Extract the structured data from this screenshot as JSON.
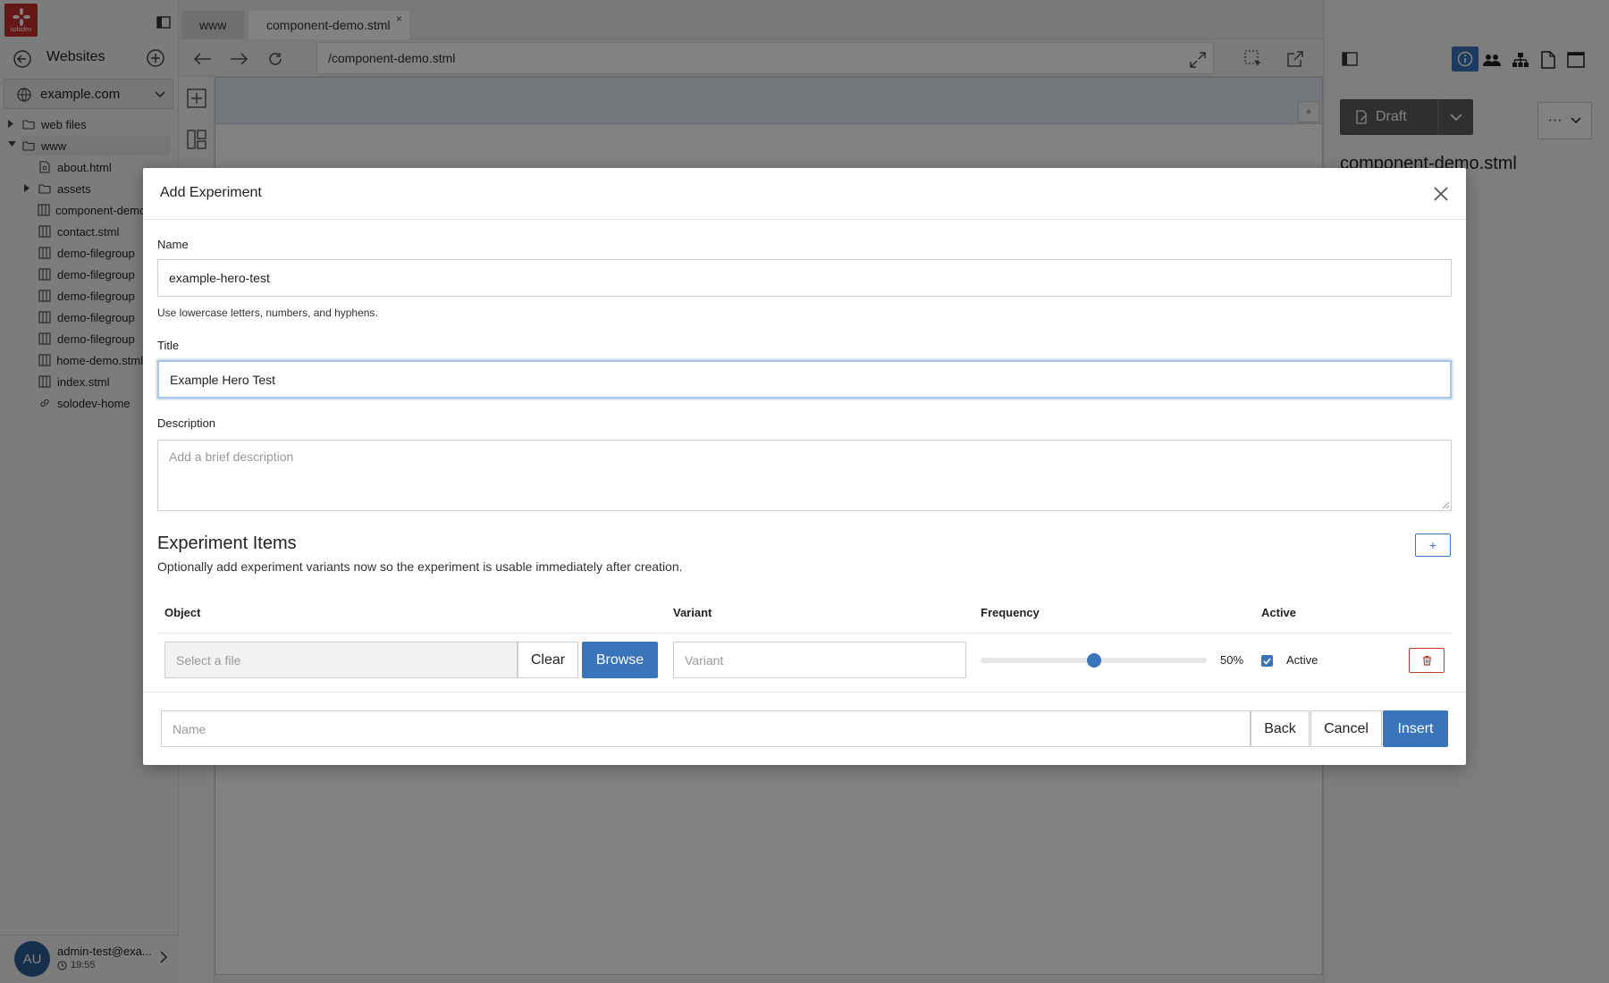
{
  "app": {
    "logo_text": "solodev"
  },
  "sidebar": {
    "websites_label": "Websites",
    "site_select": "example.com",
    "tree": [
      {
        "label": "web files",
        "type": "folder",
        "level": 0,
        "expanded": false
      },
      {
        "label": "www",
        "type": "folder",
        "level": 0,
        "expanded": true
      },
      {
        "label": "about.html",
        "type": "html",
        "level": 1
      },
      {
        "label": "assets",
        "type": "folder",
        "level": 1,
        "expanded": false
      },
      {
        "label": "component-demo.stml",
        "type": "stml",
        "level": 1
      },
      {
        "label": "contact.stml",
        "type": "stml",
        "level": 1
      },
      {
        "label": "demo-filegroup",
        "type": "stml",
        "level": 1
      },
      {
        "label": "demo-filegroup",
        "type": "stml",
        "level": 1
      },
      {
        "label": "demo-filegroup",
        "type": "stml",
        "level": 1
      },
      {
        "label": "demo-filegroup",
        "type": "stml",
        "level": 1
      },
      {
        "label": "demo-filegroup",
        "type": "stml",
        "level": 1
      },
      {
        "label": "home-demo.stml",
        "type": "stml",
        "level": 1
      },
      {
        "label": "index.stml",
        "type": "stml",
        "level": 1
      },
      {
        "label": "solodev-home",
        "type": "link",
        "level": 1
      }
    ],
    "user": {
      "initials": "AU",
      "name": "admin-test@exa...",
      "time": "19:55"
    }
  },
  "editor": {
    "tabs": [
      {
        "label": "www"
      },
      {
        "label": "component-demo.stml"
      }
    ],
    "tab_close": "×",
    "url": "/component-demo.stml",
    "canvas_plus": "+"
  },
  "right_panel": {
    "status": "Draft",
    "file_title": "component-demo.stml"
  },
  "modal": {
    "title": "Add Experiment",
    "name_label": "Name",
    "name_value": "example-hero-test",
    "name_hint": "Use lowercase letters, numbers, and hyphens.",
    "title_label": "Title",
    "title_value": "Example Hero Test",
    "description_label": "Description",
    "description_placeholder": "Add a brief description",
    "items_heading": "Experiment Items",
    "items_sub": "Optionally add experiment variants now so the experiment is usable immediately after creation.",
    "add_item_label": "+",
    "columns": {
      "object": "Object",
      "variant": "Variant",
      "frequency": "Frequency",
      "active": "Active"
    },
    "row": {
      "file_placeholder": "Select a file",
      "clear_label": "Clear",
      "browse_label": "Browse",
      "variant_placeholder": "Variant",
      "frequency": 50,
      "frequency_text": "50%",
      "active": true,
      "active_label": "Active"
    },
    "footer": {
      "name_placeholder": "Name",
      "back_label": "Back",
      "cancel_label": "Cancel",
      "insert_label": "Insert"
    }
  },
  "colors": {
    "primary": "#3a75bb",
    "danger": "#c0392b",
    "logo": "#c9302c",
    "avatar": "#2c5d95"
  }
}
